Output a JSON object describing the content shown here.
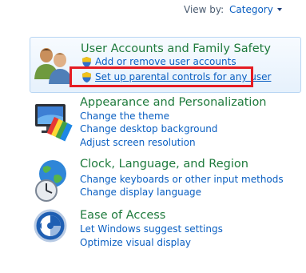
{
  "view_by": {
    "label": "View by:",
    "value": "Category"
  },
  "categories": [
    {
      "title": "User Accounts and Family Safety",
      "links": [
        "Add or remove user accounts",
        "Set up parental controls for any user"
      ]
    },
    {
      "title": "Appearance and Personalization",
      "links": [
        "Change the theme",
        "Change desktop background",
        "Adjust screen resolution"
      ]
    },
    {
      "title": "Clock, Language, and Region",
      "links": [
        "Change keyboards or other input methods",
        "Change display language"
      ]
    },
    {
      "title": "Ease of Access",
      "links": [
        "Let Windows suggest settings",
        "Optimize visual display"
      ]
    }
  ],
  "colors": {
    "title_green": "#1e7a3c",
    "link_blue": "#0a5fc2",
    "highlight_red": "#e51c23"
  },
  "icons": [
    "users-icon",
    "shield-icon",
    "appearance-icon",
    "globe-clock-icon",
    "ease-of-access-icon"
  ]
}
